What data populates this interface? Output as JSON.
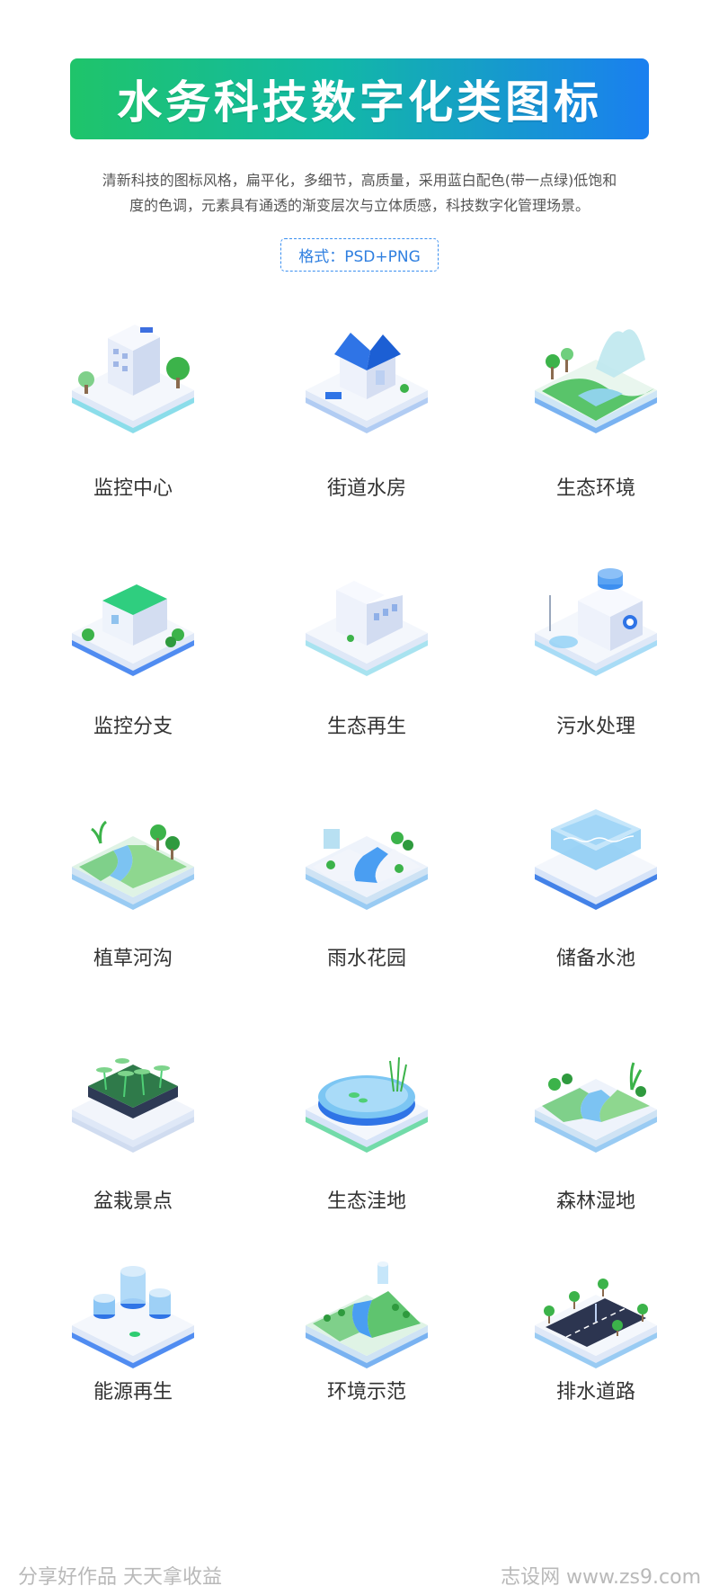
{
  "header": {
    "title": "水务科技数字化类图标",
    "description_line1": "清新科技的图标风格，扁平化，多细节，高质量，采用蓝白配色(带一点绿)低饱和",
    "description_line2": "度的色调，元素具有通透的渐变层次与立体质感，科技数字化管理场景。",
    "format": "格式：PSD+PNG"
  },
  "colors": {
    "banner_start": "#1fc46a",
    "banner_end": "#1a7ff0",
    "accent_blue": "#2f7fe0",
    "accent_green": "#2ecc71"
  },
  "icons": [
    {
      "label": "监控中心",
      "icon": "office-building-icon"
    },
    {
      "label": "街道水房",
      "icon": "house-icon"
    },
    {
      "label": "生态环境",
      "icon": "park-waterfall-icon"
    },
    {
      "label": "监控分支",
      "icon": "green-roof-building-icon"
    },
    {
      "label": "生态再生",
      "icon": "factory-building-icon"
    },
    {
      "label": "污水处理",
      "icon": "treatment-plant-icon"
    },
    {
      "label": "植草河沟",
      "icon": "grass-river-icon"
    },
    {
      "label": "雨水花园",
      "icon": "rain-garden-icon"
    },
    {
      "label": "储备水池",
      "icon": "reservoir-pool-icon"
    },
    {
      "label": "盆栽景点",
      "icon": "potted-plants-icon"
    },
    {
      "label": "生态洼地",
      "icon": "pond-icon"
    },
    {
      "label": "森林湿地",
      "icon": "forest-wetland-icon"
    },
    {
      "label": "能源再生",
      "icon": "energy-tanks-icon"
    },
    {
      "label": "环境示范",
      "icon": "demo-landscape-icon"
    },
    {
      "label": "排水道路",
      "icon": "drainage-road-icon"
    }
  ],
  "footer": {
    "left": "分享好作品 天天拿收益",
    "right": "志设网 www.zs9.com"
  }
}
